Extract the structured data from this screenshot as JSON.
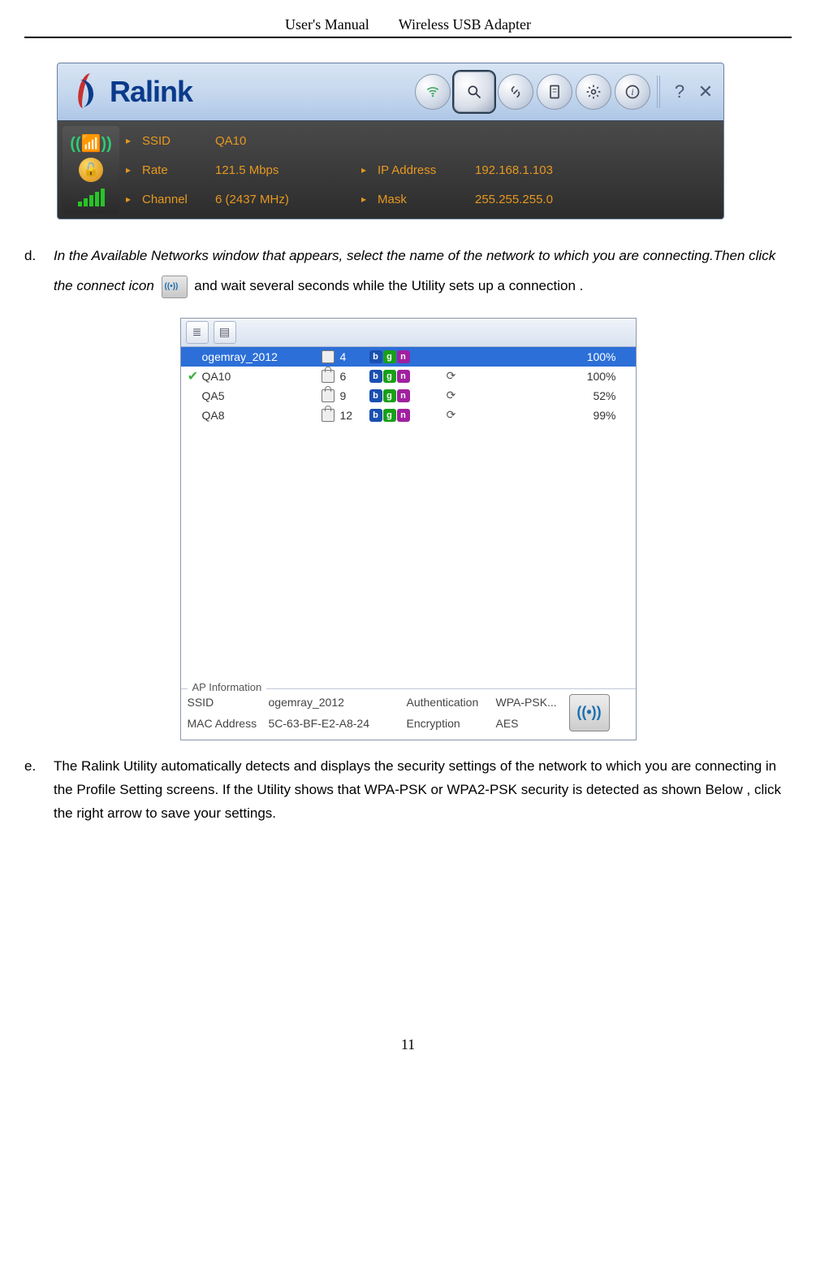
{
  "header": {
    "left": "User's Manual",
    "right": "Wireless USB Adapter"
  },
  "footer": {
    "page_number": "11"
  },
  "ralink": {
    "brand": "Ralink",
    "toolbar": {
      "wifi_icon": "wifi-icon",
      "search_icon": "search-icon",
      "link_icon": "link-icon",
      "doc_icon": "document-icon",
      "gear_icon": "gear-icon",
      "info_icon": "info-icon",
      "help_label": "?",
      "close_label": "✕"
    },
    "fields": {
      "ssid_label": "SSID",
      "ssid_value": "QA10",
      "rate_label": "Rate",
      "rate_value": "121.5 Mbps",
      "channel_label": "Channel",
      "channel_value": "6 (2437 MHz)",
      "ip_label": "IP Address",
      "ip_value": "192.168.1.103",
      "mask_label": "Mask",
      "mask_value": "255.255.255.0"
    }
  },
  "step_d": {
    "letter": "d.",
    "italic": "In the Available Networks window that appears, select the name of the network to which you are connecting.Then click the connect icon",
    "rest": "and wait several seconds while the Utility sets up a connection ."
  },
  "networks": {
    "toolbar_icons": {
      "list": "list-icon",
      "details": "details-icon"
    },
    "rows": [
      {
        "connected": false,
        "selected": true,
        "ssid": "ogemray_2012",
        "secure": true,
        "channel": "4",
        "modes": [
          "b",
          "g",
          "n"
        ],
        "refresh": false,
        "signal": "100%"
      },
      {
        "connected": true,
        "selected": false,
        "ssid": "QA10",
        "secure": false,
        "channel": "6",
        "modes": [
          "b",
          "g",
          "n"
        ],
        "refresh": true,
        "signal": "100%"
      },
      {
        "connected": false,
        "selected": false,
        "ssid": "QA5",
        "secure": false,
        "channel": "9",
        "modes": [
          "b",
          "g",
          "n"
        ],
        "refresh": true,
        "signal": "52%"
      },
      {
        "connected": false,
        "selected": false,
        "ssid": "QA8",
        "secure": false,
        "channel": "12",
        "modes": [
          "b",
          "g",
          "n"
        ],
        "refresh": true,
        "signal": "99%"
      }
    ],
    "ap_info": {
      "title": "AP Information",
      "ssid_label": "SSID",
      "ssid_value": "ogemray_2012",
      "auth_label": "Authentication",
      "auth_value": "WPA-PSK...",
      "mac_label": "MAC Address",
      "mac_value": "5C-63-BF-E2-A8-24",
      "enc_label": "Encryption",
      "enc_value": "AES",
      "connect_glyph": "((•))"
    }
  },
  "step_e": {
    "letter": "e.",
    "text": "The Ralink Utility automatically detects and displays the security settings of the network to which you are connecting in the Profile Setting screens. If the Utility shows that WPA-PSK or WPA2-PSK security is detected as shown Below , click the right arrow to save your settings."
  }
}
